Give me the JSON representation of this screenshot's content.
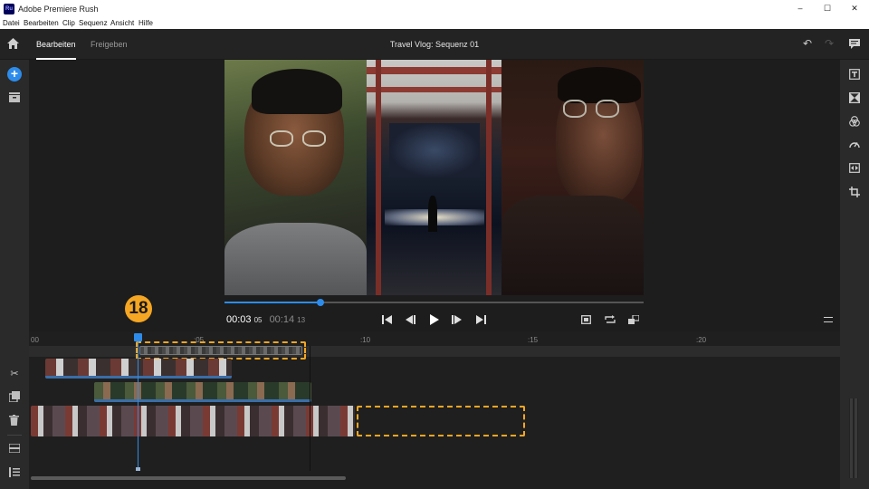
{
  "window": {
    "app_badge": "Ru",
    "title": "Adobe Premiere Rush",
    "minimize": "–",
    "maximize": "☐",
    "close": "✕"
  },
  "menu": [
    "Datei",
    "Bearbeiten",
    "Clip",
    "Sequenz",
    "Ansicht",
    "Hilfe"
  ],
  "appbar": {
    "tabs": [
      {
        "label": "Bearbeiten",
        "active": true
      },
      {
        "label": "Freigeben",
        "active": false
      }
    ],
    "project_title": "Travel Vlog: Sequenz 01"
  },
  "icons": {
    "home": "home-icon",
    "add": "add-icon",
    "media": "media-library-icon",
    "undo": "undo-icon",
    "redo": "redo-icon",
    "comment": "comment-icon",
    "titles": "titles-icon",
    "transitions": "transitions-icon",
    "color": "color-icon",
    "speed": "speed-icon",
    "audio": "audio-icon",
    "crop": "crop-icon",
    "split": "split-icon",
    "duplicate": "duplicate-icon",
    "delete": "delete-icon",
    "track_toggle": "track-toggle-icon",
    "track_list": "track-list-icon"
  },
  "player": {
    "current_time": "00:03",
    "current_frames": "05",
    "duration": "00:14",
    "duration_frames": "13",
    "progress": 0.23
  },
  "timeline": {
    "ruler_labels": [
      "00",
      ":05",
      ":10",
      ":15",
      ":20"
    ],
    "callout": "18"
  },
  "colors": {
    "accent": "#2d8ceb",
    "highlight": "#f5a623",
    "panel": "#2a2a2a",
    "clip_bar": "#3a6ea8"
  }
}
